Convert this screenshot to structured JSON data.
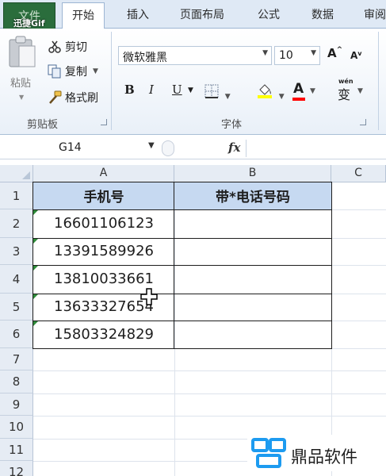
{
  "ribbon": {
    "watermark": "迅捷Gif",
    "tabs": [
      {
        "label": "文件"
      },
      {
        "label": "开始"
      },
      {
        "label": "插入"
      },
      {
        "label": "页面布局"
      },
      {
        "label": "公式"
      },
      {
        "label": "数据"
      },
      {
        "label": "审阅"
      }
    ],
    "clipboard": {
      "paste": "粘贴",
      "cut": "剪切",
      "copy": "复制",
      "format_painter": "格式刷",
      "group_label": "剪贴板"
    },
    "font": {
      "font_name": "微软雅黑",
      "font_size": "10",
      "bold": "B",
      "italic": "I",
      "underline": "U",
      "grow": "A",
      "shrink": "A",
      "font_color": "A",
      "phonetic_top": "wén",
      "phonetic_char": "变",
      "group_label": "字体"
    }
  },
  "formula_bar": {
    "name_box": "G14",
    "fx": "fx",
    "value": ""
  },
  "sheet": {
    "columns": [
      "A",
      "B",
      "C"
    ],
    "rows": [
      "1",
      "2",
      "3",
      "4",
      "5",
      "6",
      "7",
      "8",
      "9",
      "10",
      "11",
      "12"
    ],
    "table": {
      "header_a": "手机号",
      "header_b": "带*电话号码",
      "phones": [
        "16601106123",
        "13391589926",
        "13810033661",
        "13633327654",
        "15803324829"
      ]
    }
  },
  "logo": {
    "text": "鼎品软件"
  },
  "colors": {
    "header_fill": "#c6d9f1",
    "file_tab": "#2a6d3c",
    "logo_blue": "#1d9bf0"
  }
}
